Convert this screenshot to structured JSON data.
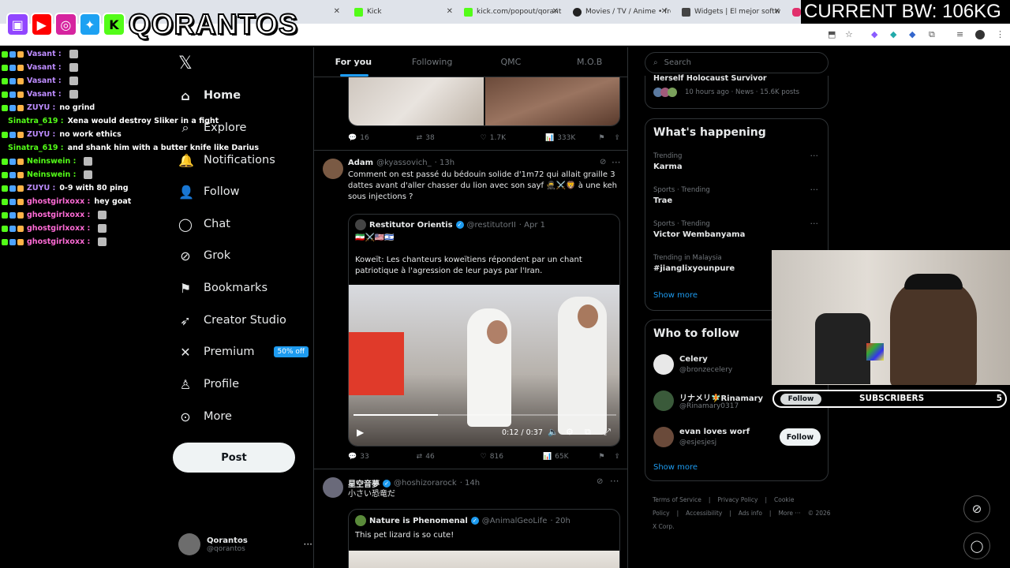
{
  "browser": {
    "tabs": [
      {
        "label": "Kick",
        "color": "#53fc18"
      },
      {
        "label": "kick.com/popout/qorant",
        "color": "#53fc18"
      },
      {
        "label": "Movies / TV / Anime • fre",
        "color": "#222222"
      },
      {
        "label": "Widgets | El mejor softw",
        "color": "#444444"
      }
    ]
  },
  "overlay": {
    "bandwidth_text": "CURRENT BW: 106KG",
    "logo_text": "QORANTOS",
    "subscribers_label": "SUBSCRIBERS",
    "subscribers_count": "5",
    "chat": [
      {
        "user": "Vasant :",
        "msg": "",
        "color": "#bd8cff"
      },
      {
        "user": "Vasant :",
        "msg": "",
        "color": "#bd8cff"
      },
      {
        "user": "Vasant :",
        "msg": "",
        "color": "#bd8cff"
      },
      {
        "user": "Vasant :",
        "msg": "",
        "color": "#bd8cff"
      },
      {
        "user": "ZUYU :",
        "msg": "no grind",
        "color": "#bd8cff"
      },
      {
        "user": "Sinatra_619 :",
        "msg": "Xena would destroy Sliker in a fight",
        "color": "#53fc18"
      },
      {
        "user": "ZUYU :",
        "msg": "no work ethics",
        "color": "#bd8cff"
      },
      {
        "user": "Sinatra_619 :",
        "msg": "and shank him with a butter knife like Darius",
        "color": "#53fc18"
      },
      {
        "user": "Neinswein :",
        "msg": "",
        "color": "#53fc18"
      },
      {
        "user": "Neinswein :",
        "msg": "",
        "color": "#53fc18"
      },
      {
        "user": "ZUYU :",
        "msg": "0-9 with 80 ping",
        "color": "#bd8cff"
      },
      {
        "user": "ghostgirlxoxx :",
        "msg": "hey goat",
        "color": "#ff6bd6"
      },
      {
        "user": "ghostgirlxoxx :",
        "msg": "",
        "color": "#ff6bd6"
      },
      {
        "user": "ghostgirlxoxx :",
        "msg": "",
        "color": "#ff6bd6"
      },
      {
        "user": "ghostgirlxoxx :",
        "msg": "",
        "color": "#ff6bd6"
      }
    ]
  },
  "nav": {
    "items": [
      {
        "label": "Home",
        "icon": "home-icon",
        "glyph": "⌂"
      },
      {
        "label": "Explore",
        "icon": "search-icon",
        "glyph": "⌕"
      },
      {
        "label": "Notifications",
        "icon": "bell-icon",
        "glyph": "🔔"
      },
      {
        "label": "Follow",
        "icon": "add-person-icon",
        "glyph": "👤"
      },
      {
        "label": "Chat",
        "icon": "chat-icon",
        "glyph": "◯"
      },
      {
        "label": "Grok",
        "icon": "grok-icon",
        "glyph": "⊘"
      },
      {
        "label": "Bookmarks",
        "icon": "bookmark-icon",
        "glyph": "⚑"
      },
      {
        "label": "Creator Studio",
        "icon": "rocket-icon",
        "glyph": "➶"
      },
      {
        "label": "Premium",
        "icon": "x-logo-icon",
        "glyph": "✕"
      },
      {
        "label": "Profile",
        "icon": "person-icon",
        "glyph": "♙"
      },
      {
        "label": "More",
        "icon": "more-circle-icon",
        "glyph": "⊙"
      }
    ],
    "premium_badge": "50% off",
    "post_label": "Post",
    "account_name": "Qorantos",
    "account_handle": "@qorantos"
  },
  "feed": {
    "tabs": [
      "For you",
      "Following",
      "QMC",
      "M.O.B"
    ],
    "tweet0_actions": {
      "replies": "16",
      "reposts": "38",
      "likes": "1.7K",
      "views": "333K"
    },
    "tweet1": {
      "name": "Adam",
      "handle": "@kyassovich_",
      "time": "· 13h",
      "text": "Comment on est passé du bédouin solide d'1m72 qui allait graille 3 dattes avant d'aller chasser du lion avec son sayf 🥷⚔️🦁 à une keh sous injections ?",
      "quote_name": "Restitutor Orientis",
      "quote_handle": "@restitutorII",
      "quote_time": "· Apr 1",
      "quote_flags": "🇮🇷⚔️🇺🇸🇮🇱",
      "quote_text": "Koweït: Les chanteurs koweïtiens répondent par un chant patriotique à l'agression de leur pays par l'Iran.",
      "video_time": "0:12 / 0:37",
      "video_progress": 0.32,
      "replies": "33",
      "reposts": "46",
      "likes": "816",
      "views": "65K"
    },
    "tweet2": {
      "name": "星空音夢",
      "handle": "@hoshizorarock",
      "time": "· 14h",
      "text": "小さい恐竜だ",
      "quote_name": "Nature is Phenomenal",
      "quote_handle": "@AnimalGeoLife",
      "quote_time": "· 20h",
      "quote_text": "This pet lizard is so cute!"
    }
  },
  "sidebar": {
    "search_placeholder": "Search",
    "top_snippet_title": "Herself Holocaust Survivor",
    "top_snippet_meta": "10 hours ago · News · 15.6K posts",
    "happening_title": "What's happening",
    "trends": [
      {
        "meta": "Trending",
        "name": "Karma"
      },
      {
        "meta": "Sports · Trending",
        "name": "Trae"
      },
      {
        "meta": "Sports · Trending",
        "name": "Victor Wembanyama"
      },
      {
        "meta": "Trending in Malaysia",
        "name": "#jianglixyounpure"
      }
    ],
    "show_more": "Show more",
    "who_title": "Who to follow",
    "who": [
      {
        "name": "Celery",
        "handle": "@bronzecelery",
        "follow": "Follow",
        "color": "#e8e8e8"
      },
      {
        "name": "リナメリ🧚Rinamary",
        "handle": "@Rinamary0317",
        "follow": "Follow",
        "color": "#3a5a3a"
      },
      {
        "name": "evan loves worf",
        "handle": "@esjesjesj",
        "follow": "Follow",
        "color": "#6a4a3a"
      }
    ],
    "footer_links": [
      "Terms of Service",
      "|",
      "Privacy Policy",
      "|",
      "Cookie Policy",
      "|",
      "Accessibility",
      "|",
      "Ads info",
      "|",
      "More ···",
      "© 2026 X Corp."
    ]
  }
}
